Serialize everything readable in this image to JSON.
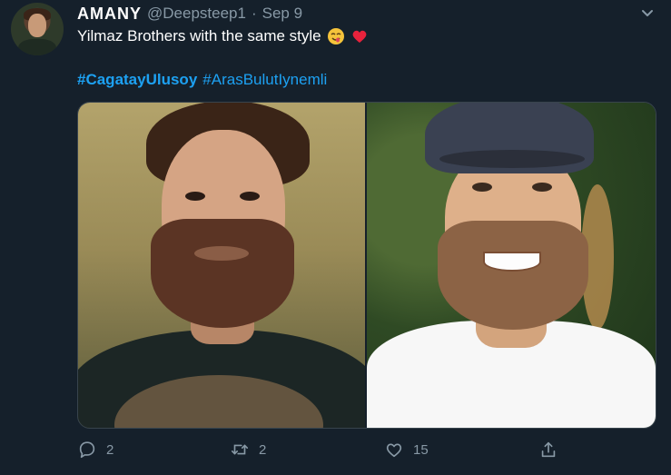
{
  "tweet": {
    "author": {
      "display_name": "AMANY",
      "handle": "@Deepsteep1",
      "separator": "·",
      "date": "Sep 9"
    },
    "text": "Yilmaz Brothers with the same style",
    "emojis": [
      "yum-face-emoji",
      "red-heart-emoji"
    ],
    "hashtags": [
      "#CagatayUlusoy",
      "#ArasBulutIynemli"
    ],
    "media": [
      {
        "name": "left-photo",
        "description_icon": "man-dark-tshirt"
      },
      {
        "name": "right-photo",
        "description_icon": "man-white-tshirt-cap"
      }
    ],
    "actions": {
      "reply_count": "2",
      "retweet_count": "2",
      "like_count": "15"
    }
  },
  "colors": {
    "background": "#15202b",
    "text": "#ffffff",
    "muted": "#8899a6",
    "link": "#1da1f2",
    "border": "#38444d"
  }
}
